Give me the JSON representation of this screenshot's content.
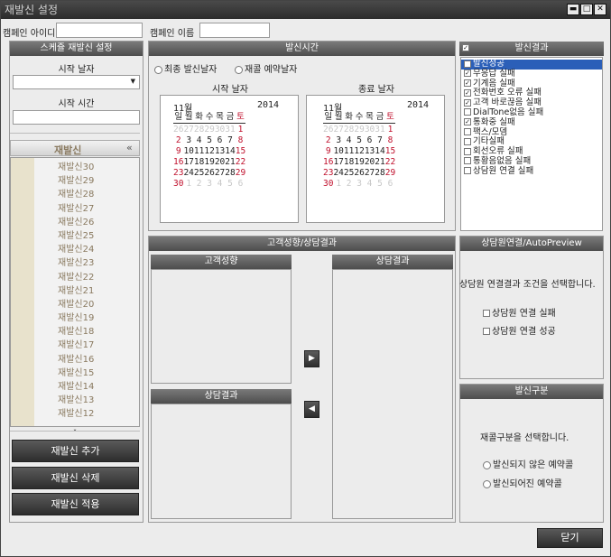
{
  "window": {
    "title": "재발신 설정",
    "btn_min": "▬",
    "btn_max": "□",
    "btn_close": "✕"
  },
  "campaign": {
    "id_label": "캠페인 아이디",
    "id_value": "",
    "name_label": "캠페인 이름",
    "name_value": ""
  },
  "schedule": {
    "header": "스케쥴 재발신 설정",
    "start_date_label": "시작 날자",
    "start_date_value": "",
    "start_time_label": "시작 시간",
    "start_time_value": ""
  },
  "redial": {
    "header": "재발신",
    "collapse_icon": "«",
    "items": [
      "재발신30",
      "재발신29",
      "재발신28",
      "재발신27",
      "재발신26",
      "재발신25",
      "재발신24",
      "재발신23",
      "재발신22",
      "재발신21",
      "재발신20",
      "재발신19",
      "재발신18",
      "재발신17",
      "재발신16",
      "재발신15",
      "재발신14",
      "재발신13",
      "재발신12"
    ],
    "add_btn": "재발신 추가",
    "del_btn": "재발신 삭제",
    "apply_btn": "재발신 적용"
  },
  "send_time": {
    "header": "발신시간",
    "radio1": "최종 발신날자",
    "radio2": "재콜 예약날자",
    "start_label": "시작 날자",
    "end_label": "종료 날자",
    "cal": {
      "month": "11월",
      "year": "2014",
      "weekdays": [
        "일",
        "월",
        "화",
        "수",
        "목",
        "금",
        "토"
      ],
      "weeks": [
        [
          [
            "26",
            0
          ],
          [
            "27",
            0
          ],
          [
            "28",
            0
          ],
          [
            "29",
            0
          ],
          [
            "30",
            0
          ],
          [
            "31",
            0
          ],
          [
            "1",
            1
          ]
        ],
        [
          [
            "2",
            1
          ],
          [
            "3",
            1
          ],
          [
            "4",
            1
          ],
          [
            "5",
            1
          ],
          [
            "6",
            1
          ],
          [
            "7",
            1
          ],
          [
            "8",
            1
          ]
        ],
        [
          [
            "9",
            1
          ],
          [
            "10",
            1
          ],
          [
            "11",
            1
          ],
          [
            "12",
            1
          ],
          [
            "13",
            1
          ],
          [
            "14",
            1
          ],
          [
            "15",
            1
          ]
        ],
        [
          [
            "16",
            1
          ],
          [
            "17",
            1
          ],
          [
            "18",
            1
          ],
          [
            "19",
            1
          ],
          [
            "20",
            1
          ],
          [
            "21",
            1
          ],
          [
            "22",
            1
          ]
        ],
        [
          [
            "23",
            1
          ],
          [
            "24",
            1
          ],
          [
            "25",
            1
          ],
          [
            "26",
            1
          ],
          [
            "27",
            1
          ],
          [
            "28",
            1
          ],
          [
            "29",
            1
          ]
        ],
        [
          [
            "30",
            1
          ],
          [
            "1",
            0
          ],
          [
            "2",
            0
          ],
          [
            "3",
            0
          ],
          [
            "4",
            0
          ],
          [
            "5",
            0
          ],
          [
            "6",
            0
          ]
        ]
      ]
    }
  },
  "result": {
    "header": "발신결과",
    "items": [
      {
        "label": "발신성공",
        "checked": false,
        "selected": true
      },
      {
        "label": "무응답 실패",
        "checked": true,
        "selected": false
      },
      {
        "label": "기계음 실패",
        "checked": true,
        "selected": false
      },
      {
        "label": "전화번호 오류 실패",
        "checked": true,
        "selected": false
      },
      {
        "label": "고객 바로끊음 실패",
        "checked": true,
        "selected": false
      },
      {
        "label": "DialTone없음 실패",
        "checked": false,
        "selected": false
      },
      {
        "label": "통화중 실패",
        "checked": true,
        "selected": false
      },
      {
        "label": "팩스/모뎀",
        "checked": false,
        "selected": false
      },
      {
        "label": "기타실패",
        "checked": false,
        "selected": false
      },
      {
        "label": "회선오류 실패",
        "checked": false,
        "selected": false
      },
      {
        "label": "통황음없음 실패",
        "checked": false,
        "selected": false
      },
      {
        "label": "상담원 연결 실패",
        "checked": false,
        "selected": false
      }
    ]
  },
  "customer": {
    "header": "고객성향/상담결과",
    "tendency": "고객성향",
    "result_right": "상담결과",
    "result_left": "상담결과",
    "move_right": "▶",
    "move_left": "◀"
  },
  "agent": {
    "header": "상담원연결/AutoPreview",
    "desc": "상담원 연결결과 조건을 선택합니다.",
    "opt1": "상담원 연결 실패",
    "opt2": "상담원 연결 성공"
  },
  "send_type": {
    "header": "발신구분",
    "desc": "재콜구분을 선택합니다.",
    "opt1": "발신되지 않은 예약콜",
    "opt2": "발신되어진 예약콜"
  },
  "close_btn": "닫기",
  "colors": {
    "sunday": "#c0102c",
    "muted": "#c8c8c8",
    "selected": "#2b5fb8"
  }
}
